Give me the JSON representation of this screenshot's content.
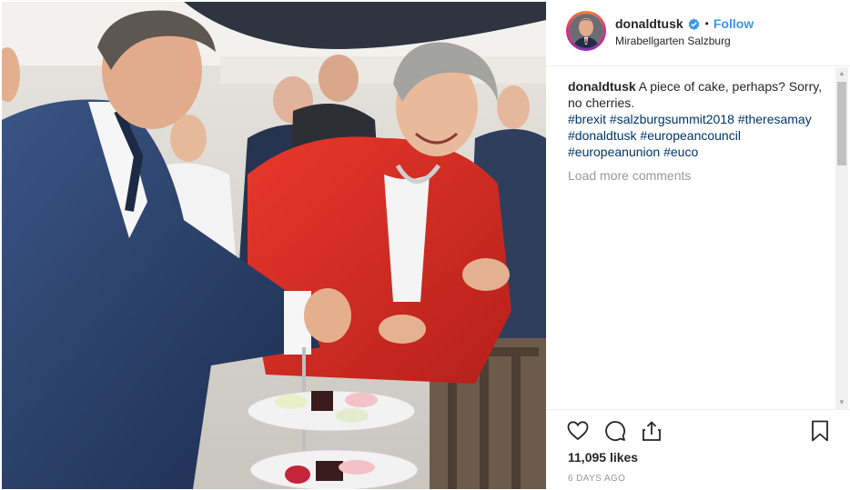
{
  "post": {
    "image_alt": "Two leaders at a cake stand at the Salzburg summit"
  },
  "header": {
    "username": "donaldtusk",
    "separator": "•",
    "follow_label": "Follow",
    "location": "Mirabellgarten Salzburg"
  },
  "caption": {
    "username": "donaldtusk",
    "text": "A piece of cake, perhaps? Sorry, no cherries.",
    "hashtags": [
      "#brexit",
      "#salzburgsummit2018",
      "#theresamay",
      "#donaldtusk",
      "#europeancouncil",
      "#europeanunion",
      "#euco"
    ]
  },
  "comments": {
    "load_more_label": "Load more comments"
  },
  "actions": {
    "likes_text": "11,095 likes",
    "time_text": "6 DAYS AGO"
  },
  "icons": {
    "verified": "verified-badge-icon",
    "like": "heart-icon",
    "comment": "comment-icon",
    "share": "share-icon",
    "save": "bookmark-icon"
  },
  "colors": {
    "link_blue": "#3897f0",
    "hashtag_blue": "#003569",
    "muted_text": "#999999",
    "text": "#262626"
  }
}
